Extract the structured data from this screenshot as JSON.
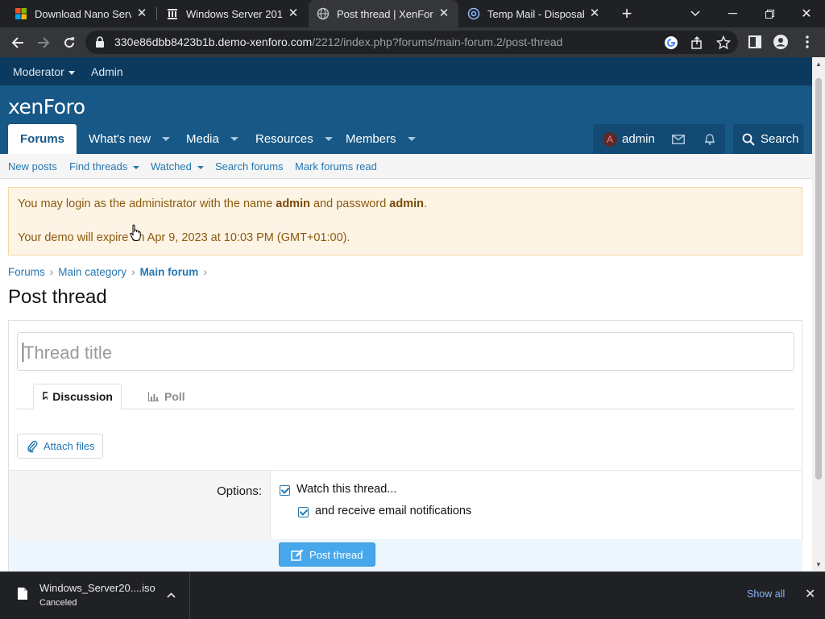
{
  "browser": {
    "tabs": [
      {
        "title": "Download Nano Server",
        "active": false,
        "favicon": "windows-logo-icon"
      },
      {
        "title": "Windows Server 2016 :",
        "active": false,
        "favicon": "building-icon"
      },
      {
        "title": "Post thread | XenForo d",
        "active": true,
        "favicon": "globe-icon"
      },
      {
        "title": "Temp Mail - Disposable",
        "active": false,
        "favicon": "at-sign-icon"
      }
    ],
    "url_host": "330e86dbb8423b1b.demo-xenforo.com",
    "url_path": "/2212/index.php?forums/main-forum.2/post-thread"
  },
  "staffbar": {
    "moderator": "Moderator",
    "admin": "Admin"
  },
  "header": {
    "logo": "xenForo",
    "nav": [
      {
        "label": "Forums",
        "active": true
      },
      {
        "label": "What's new"
      },
      {
        "label": "Media"
      },
      {
        "label": "Resources"
      },
      {
        "label": "Members"
      }
    ],
    "user_initial": "A",
    "username": "admin",
    "search_label": "Search"
  },
  "subnav": {
    "new_posts": "New posts",
    "find_threads": "Find threads",
    "watched": "Watched",
    "search_forums": "Search forums",
    "mark_read": "Mark forums read"
  },
  "notice": {
    "line1_pre": "You may login as the administrator with the name ",
    "line1_name": "admin",
    "line1_mid": " and password ",
    "line1_pass": "admin",
    "line1_end": ".",
    "line2": "Your demo will expire on Apr 9, 2023 at 10:03 PM (GMT+01:00)."
  },
  "breadcrumbs": [
    "Forums",
    "Main category",
    "Main forum"
  ],
  "page_title": "Post thread",
  "form": {
    "title_placeholder": "Thread title",
    "tab_discussion": "Discussion",
    "tab_poll": "Poll",
    "attach_label": "Attach files",
    "options_label": "Options:",
    "watch_label": "Watch this thread...",
    "email_label": "and receive email notifications",
    "submit_label": "Post thread"
  },
  "downloads": {
    "filename": "Windows_Server20....iso",
    "status": "Canceled",
    "show_all": "Show all"
  }
}
